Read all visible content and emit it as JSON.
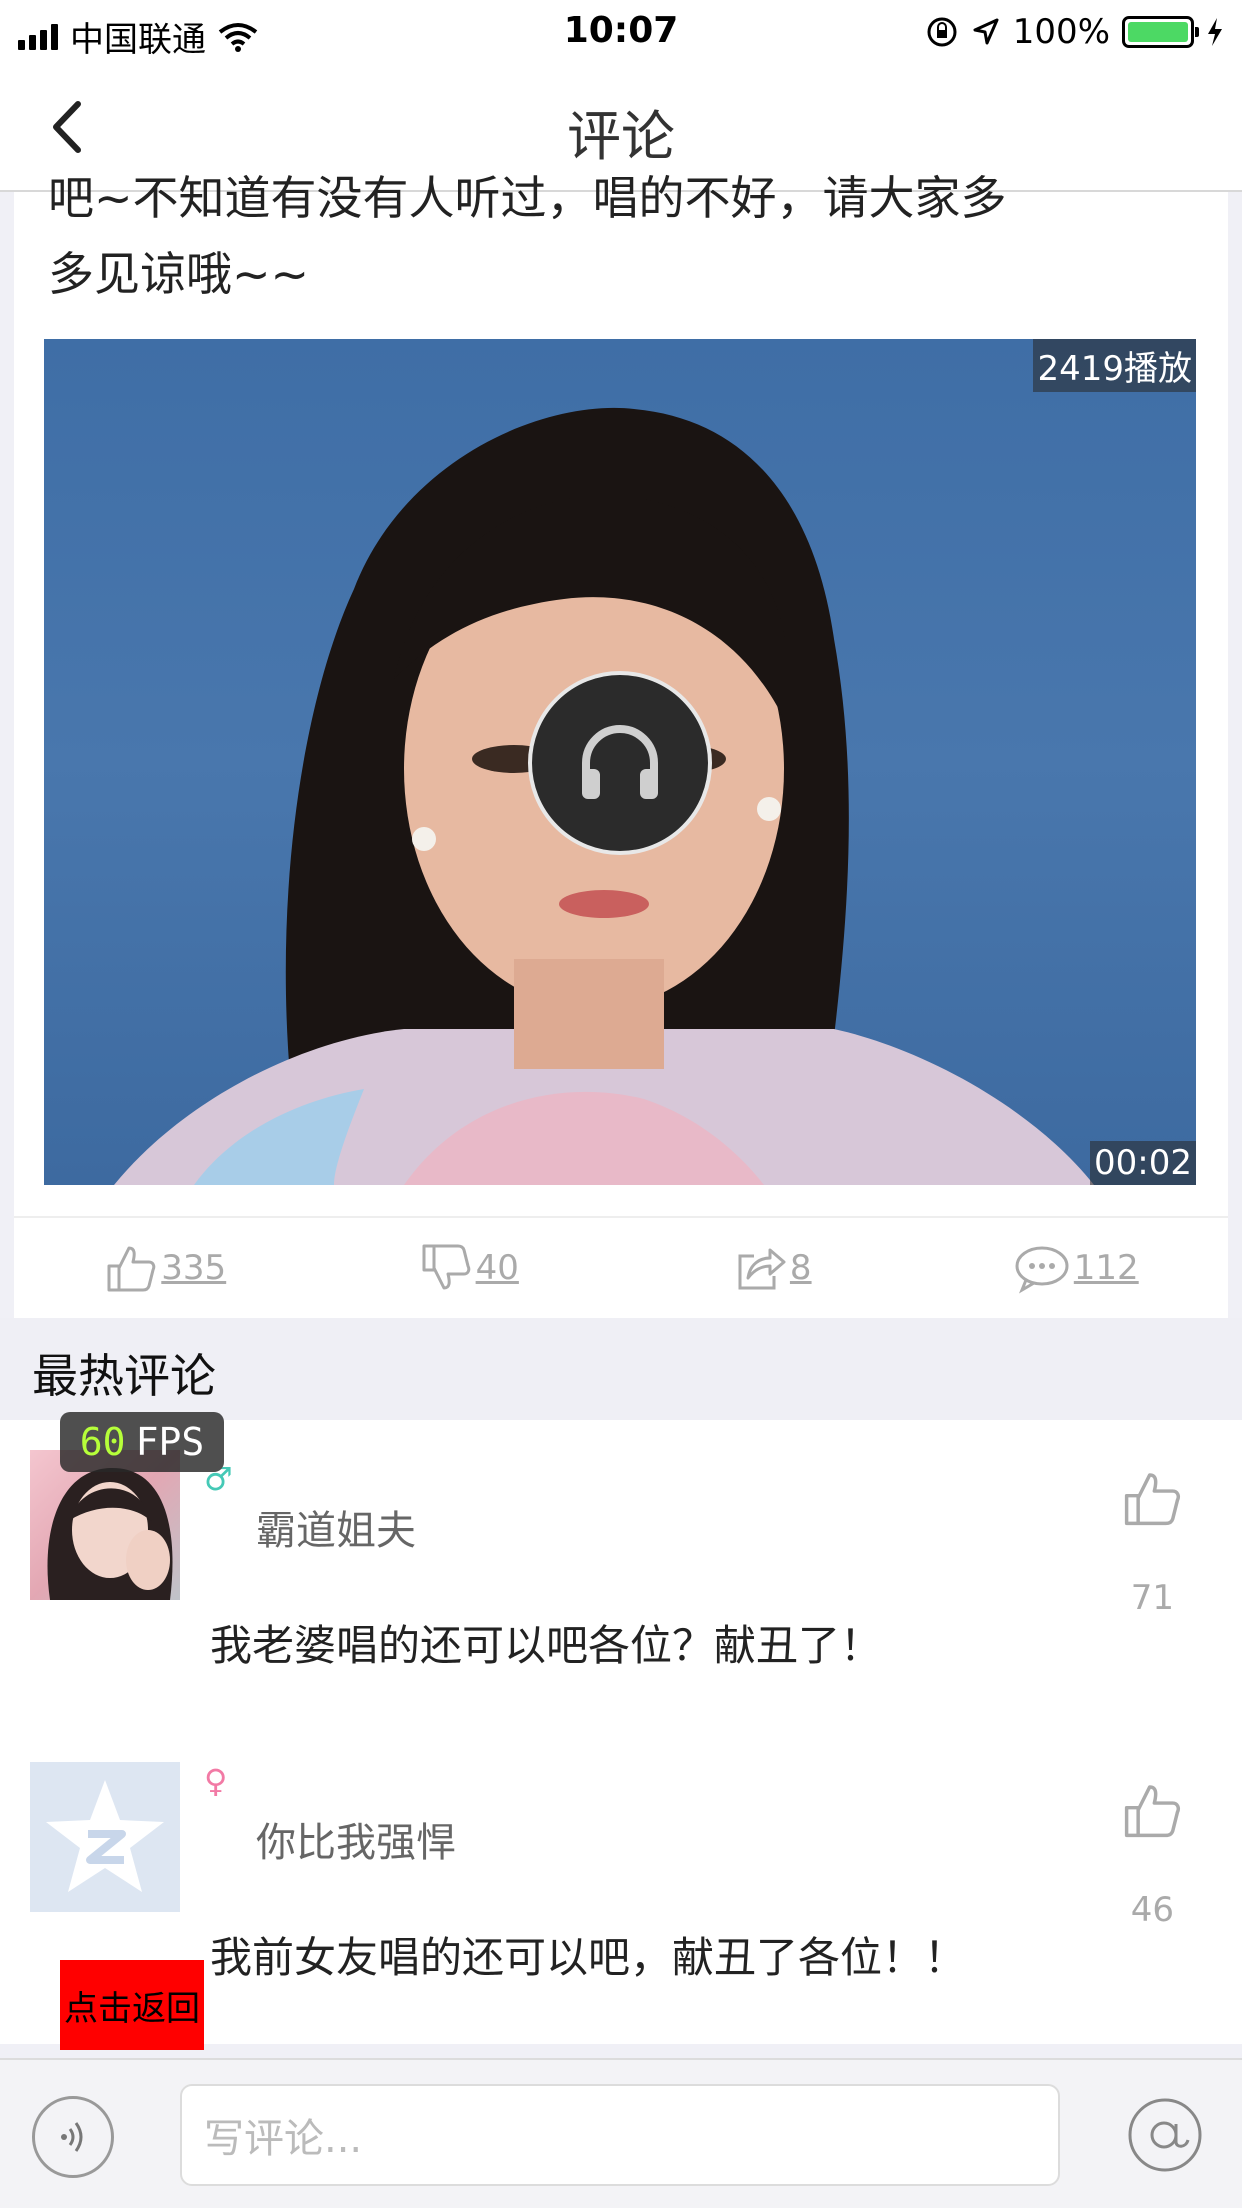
{
  "status_bar": {
    "carrier": "中国联通",
    "time": "10:07",
    "battery_percent": "100%",
    "battery_level": 1.0,
    "battery_color": "#4cd964"
  },
  "nav": {
    "title": "评论",
    "back_icon": "chevron-left-icon"
  },
  "post": {
    "text_line1": "吧~不知道有没有人听过，唱的不好，请大家多",
    "text_line2": "多见谅哦~~",
    "play_count": "2419播放",
    "duration": "00:02",
    "play_icon": "headphones-icon",
    "actions": [
      {
        "icon": "thumbs-up-icon",
        "count": "335"
      },
      {
        "icon": "thumbs-down-icon",
        "count": "40"
      },
      {
        "icon": "share-icon",
        "count": "8"
      },
      {
        "icon": "comment-bubble-icon",
        "count": "112"
      }
    ]
  },
  "section": {
    "title": "最热评论"
  },
  "comments": [
    {
      "gender_symbol": "♂",
      "username": "霸道姐夫",
      "text": "我老婆唱的还可以吧各位？献丑了！",
      "likes": "71"
    },
    {
      "gender_symbol": "♀",
      "username": "你比我强悍",
      "text": "我前女友唱的还可以吧，献丑了各位！！",
      "likes": "46"
    }
  ],
  "overlays": {
    "fps_value": "60",
    "fps_label": "FPS",
    "back_label": "点击返回"
  },
  "input_bar": {
    "placeholder": "写评论...",
    "voice_icon": "voice-icon",
    "at_icon": "at-icon"
  }
}
